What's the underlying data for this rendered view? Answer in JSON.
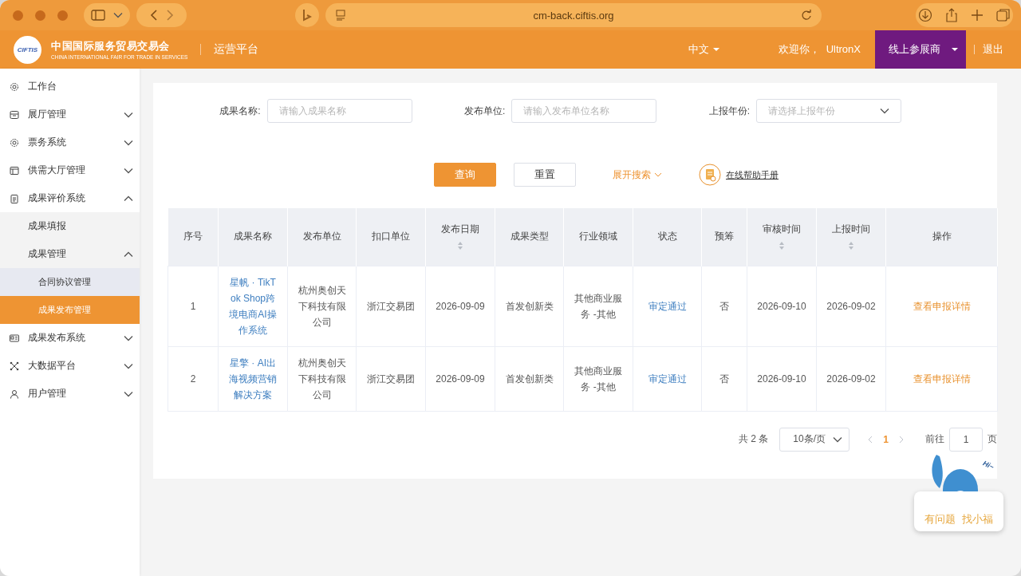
{
  "browser": {
    "url": "cm-back.ciftis.org"
  },
  "header": {
    "logo_badge": "CIFTIS",
    "logo_title": "中国国际服务贸易交易会",
    "logo_subtitle": "CHINA INTERNATIONAL FAIR FOR TRADE IN SERVICES",
    "platform": "运营平台",
    "language": "中文",
    "welcome": "欢迎你，  UltronX",
    "role": "线上参展商",
    "logout": "退出"
  },
  "sidebar": {
    "items": [
      {
        "label": "工作台",
        "kind": "link",
        "selected": false
      },
      {
        "label": "展厅管理",
        "kind": "group",
        "expanded": false
      },
      {
        "label": "票务系统",
        "kind": "group",
        "expanded": false
      },
      {
        "label": "供需大厅管理",
        "kind": "group",
        "expanded": false
      },
      {
        "label": "成果评价系统",
        "kind": "group",
        "expanded": true,
        "children": [
          {
            "label": "成果填报",
            "kind": "link",
            "selected": false
          },
          {
            "label": "成果管理",
            "kind": "group",
            "expanded": true,
            "children": [
              {
                "label": "合同协议管理",
                "kind": "link",
                "selected": false
              },
              {
                "label": "成果发布管理",
                "kind": "link",
                "selected": true
              }
            ]
          }
        ]
      },
      {
        "label": "成果发布系统",
        "kind": "group",
        "expanded": false
      },
      {
        "label": "大数据平台",
        "kind": "group",
        "expanded": false
      },
      {
        "label": "用户管理",
        "kind": "group",
        "expanded": false
      }
    ]
  },
  "filters": [
    {
      "label": "成果名称:",
      "placeholder": "请输入成果名称",
      "kind": "text"
    },
    {
      "label": "发布单位:",
      "placeholder": "请输入发布单位名称",
      "kind": "text"
    },
    {
      "label": "上报年份:",
      "placeholder": "请选择上报年份",
      "kind": "select"
    }
  ],
  "actions": {
    "query": "查询",
    "reset": "重置",
    "expand": "展开搜索",
    "help": "在线帮助手册"
  },
  "table": {
    "columns": [
      {
        "label": "序号",
        "kind": "text",
        "sortable": false
      },
      {
        "label": "成果名称",
        "kind": "link",
        "sortable": false
      },
      {
        "label": "发布单位",
        "kind": "text",
        "sortable": false
      },
      {
        "label": "扣口单位",
        "kind": "text",
        "sortable": false
      },
      {
        "label": "发布日期",
        "kind": "text",
        "sortable": true
      },
      {
        "label": "成果类型",
        "kind": "text",
        "sortable": false
      },
      {
        "label": "行业领域",
        "kind": "text",
        "sortable": false
      },
      {
        "label": "状态",
        "kind": "link",
        "sortable": false
      },
      {
        "label": "预筹",
        "kind": "text",
        "sortable": false
      },
      {
        "label": "审核时间",
        "kind": "text",
        "sortable": true
      },
      {
        "label": "上报时间",
        "kind": "text",
        "sortable": true
      },
      {
        "label": "操作",
        "kind": "action",
        "sortable": false
      }
    ],
    "rows": [
      {
        "cells": [
          "1",
          "星帆 · TikTok Shop跨境电商AI操作系统",
          "杭州奥创天下科技有限公司",
          "浙江交易团",
          "2026-09-09",
          "首发创新类",
          "其他商业服务 -其他",
          "审定通过",
          "否",
          "2026-09-10",
          "2026-09-02",
          "查看申报详情"
        ]
      },
      {
        "cells": [
          "2",
          "星擎 · AI出海视频营销解决方案",
          "杭州奥创天下科技有限公司",
          "浙江交易团",
          "2026-09-09",
          "首发创新类",
          "其他商业服务 -其他",
          "审定通过",
          "否",
          "2026-09-10",
          "2026-09-02",
          "查看申报详情"
        ]
      }
    ]
  },
  "pagination": {
    "total": "共 2 条",
    "page_size": "10条/页",
    "pages": [
      {
        "label": "1",
        "selected": true
      }
    ],
    "goto_label": "前往",
    "goto_value": "1",
    "page_unit": "页"
  },
  "helper": {
    "greeting": "Hi~",
    "caption_1": "有问题",
    "caption_2": "找小福"
  }
}
